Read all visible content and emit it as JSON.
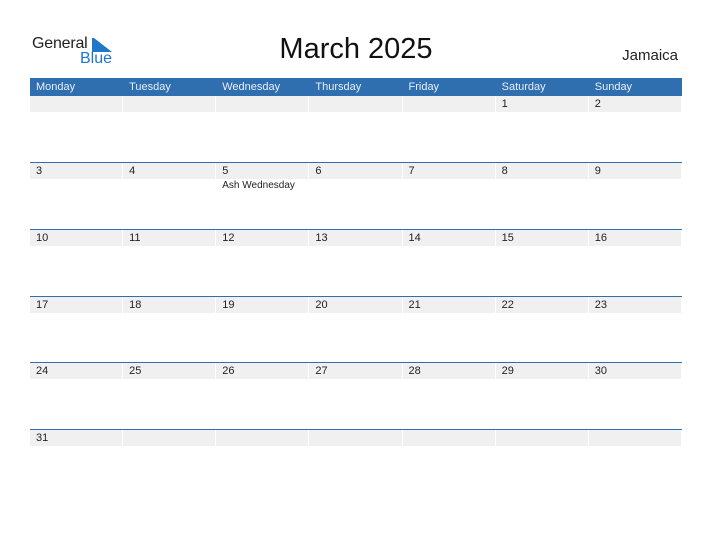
{
  "logo": {
    "general": "General",
    "blue": "Blue",
    "brand_color": "#1f77c8"
  },
  "title": "March 2025",
  "country": "Jamaica",
  "header_color": "#2f6fb0",
  "weekdays": [
    "Monday",
    "Tuesday",
    "Wednesday",
    "Thursday",
    "Friday",
    "Saturday",
    "Sunday"
  ],
  "weeks": [
    {
      "days": [
        {
          "d": ""
        },
        {
          "d": ""
        },
        {
          "d": ""
        },
        {
          "d": ""
        },
        {
          "d": ""
        },
        {
          "d": "1"
        },
        {
          "d": "2"
        }
      ]
    },
    {
      "days": [
        {
          "d": "3"
        },
        {
          "d": "4"
        },
        {
          "d": "5",
          "event": "Ash Wednesday"
        },
        {
          "d": "6"
        },
        {
          "d": "7"
        },
        {
          "d": "8"
        },
        {
          "d": "9"
        }
      ]
    },
    {
      "days": [
        {
          "d": "10"
        },
        {
          "d": "11"
        },
        {
          "d": "12"
        },
        {
          "d": "13"
        },
        {
          "d": "14"
        },
        {
          "d": "15"
        },
        {
          "d": "16"
        }
      ]
    },
    {
      "days": [
        {
          "d": "17"
        },
        {
          "d": "18"
        },
        {
          "d": "19"
        },
        {
          "d": "20"
        },
        {
          "d": "21"
        },
        {
          "d": "22"
        },
        {
          "d": "23"
        }
      ]
    },
    {
      "days": [
        {
          "d": "24"
        },
        {
          "d": "25"
        },
        {
          "d": "26"
        },
        {
          "d": "27"
        },
        {
          "d": "28"
        },
        {
          "d": "29"
        },
        {
          "d": "30"
        }
      ]
    },
    {
      "days": [
        {
          "d": "31"
        },
        {
          "d": ""
        },
        {
          "d": ""
        },
        {
          "d": ""
        },
        {
          "d": ""
        },
        {
          "d": ""
        },
        {
          "d": ""
        }
      ]
    }
  ]
}
